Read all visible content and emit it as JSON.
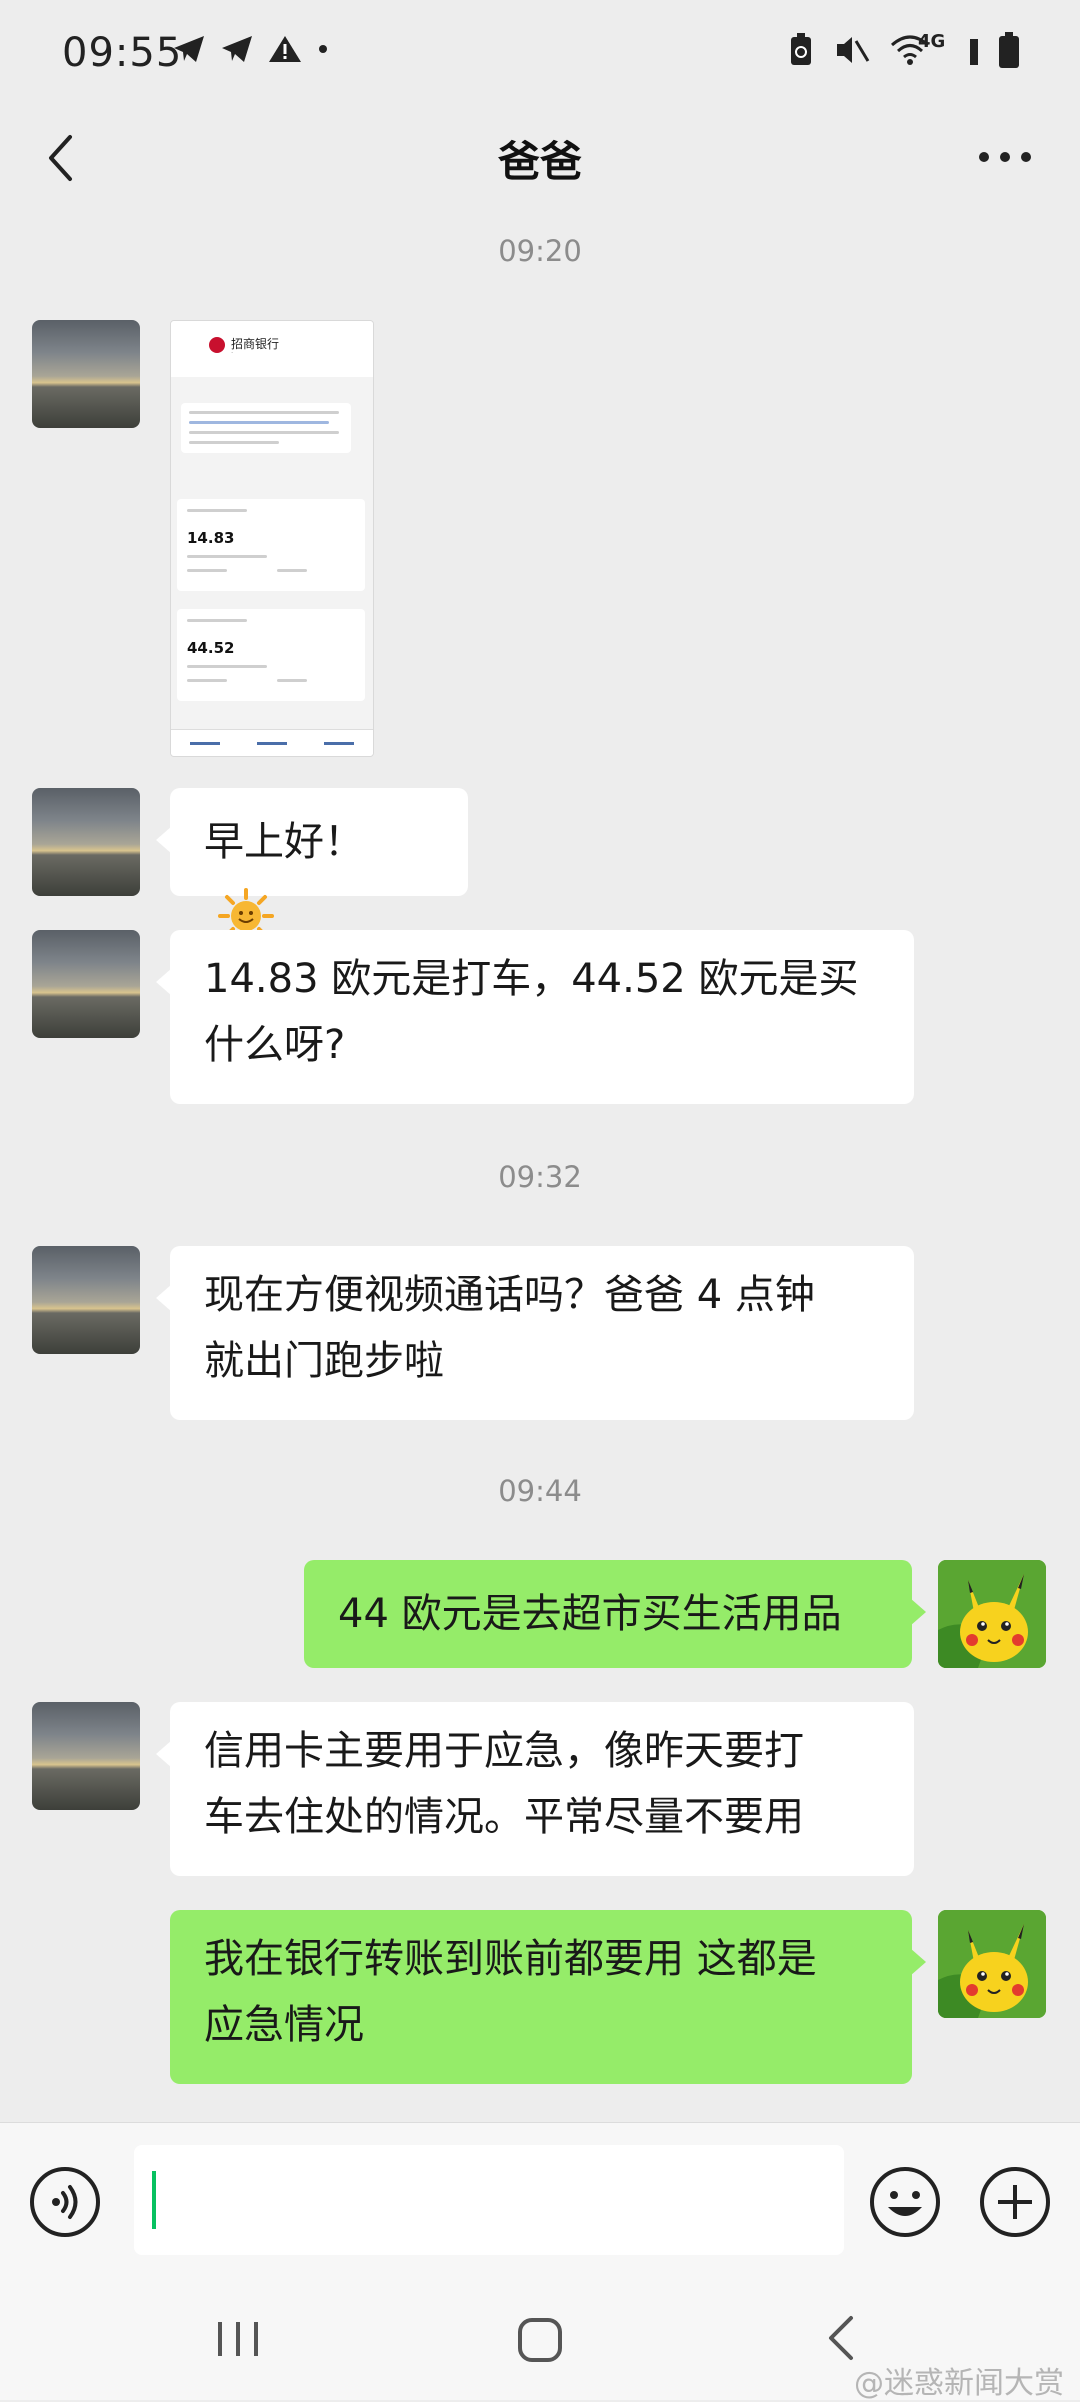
{
  "status": {
    "time": "09:55",
    "network": "4G",
    "left_icons": [
      "telegram-icon",
      "telegram-icon",
      "warning-icon",
      "dot-icon"
    ],
    "right_icons": [
      "recycle-icon",
      "mute-icon",
      "wifi-icon",
      "signal-icon",
      "battery-icon"
    ]
  },
  "header": {
    "title": "爸爸"
  },
  "chat": {
    "timestamps": [
      "09:20",
      "09:32",
      "09:44"
    ],
    "messages": [
      {
        "side": "left",
        "type": "image",
        "content": "bank-sms-screenshot"
      },
      {
        "side": "left",
        "type": "text",
        "text": "早上好！",
        "emoji": "🌞"
      },
      {
        "side": "left",
        "type": "text",
        "lines": [
          "14.83 欧元是打车，44.52 欧元是买",
          "什么呀?"
        ]
      },
      {
        "side": "left",
        "type": "text",
        "lines": [
          "现在方便视频通话吗？爸爸 4 点钟",
          "就出门跑步啦"
        ]
      },
      {
        "side": "right",
        "type": "text",
        "text": "44 欧元是去超市买生活用品"
      },
      {
        "side": "left",
        "type": "text",
        "lines": [
          "信用卡主要用于应急，像昨天要打",
          "车去住处的情况。平常尽量不要用"
        ]
      },
      {
        "side": "right",
        "type": "text",
        "lines": [
          "我在银行转账到账前都要用 这都是",
          "应急情况"
        ]
      }
    ]
  },
  "screenshot": {
    "bank_name": "招商银行",
    "amount1": "14.83",
    "amount2": "44.52"
  },
  "watermark": "@迷惑新闻大赏",
  "colors": {
    "bg": "#ededed",
    "bubble_green": "#95ec69",
    "bubble_white": "#ffffff",
    "caret": "#07c160"
  }
}
